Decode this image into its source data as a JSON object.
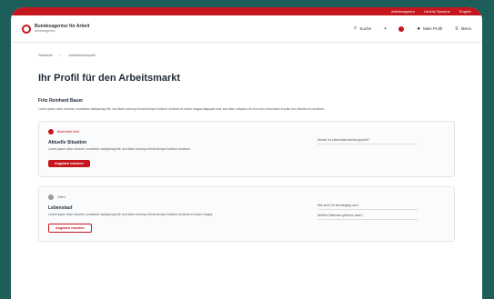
{
  "topbar": {
    "links": [
      "Arbeitsagentur",
      "Leichte Sprache",
      "English"
    ]
  },
  "header": {
    "logo_title": "Bundesagentur für Arbeit",
    "logo_sub": "Arbeitsagentur",
    "nav": {
      "search": "Suche",
      "profile": "Mein Profil",
      "menu": "Menü"
    }
  },
  "breadcrumb": [
    "Startseite",
    "Arbeitsmarktprofil"
  ],
  "page": {
    "title": "Ihr Profil für den Arbeitsmarkt",
    "name": "Fritz Reinhard Bauer",
    "intro": "Lorem ipsum dolor sit amet, consetetur sadipscing elitr, sed diam nonumy eirmod tempor invidunt ut labore et dolore magna aliquyam erat, sed diam voluptua. At vero eos et accusam et justo duo dolores et ea rebum."
  },
  "cards": [
    {
      "status": "Bearbeitet fehlt",
      "title": "Aktuelle Situation",
      "text": "Lorem ipsum dolor sit amet, consetetur sadipscing elitr, sed diam nonumy eirmod tempor invidunt ut labore.",
      "button": "Angaben machen",
      "aside": [
        "Wurde Ihr Lebenslauf bereits geprüft?"
      ]
    },
    {
      "status": "Offen",
      "title": "Lebenslauf",
      "text": "Lorem ipsum dolor sit amet, consetetur sadipscing elitr, sed diam nonumy eirmod tempor invidunt ut labore et dolore magna.",
      "button": "Angaben machen",
      "aside": [
        "Wie sieht Ihr Werdegang aus?",
        "Welche Stationen gehören dazu?"
      ]
    }
  ],
  "colors": {
    "brand": "#c4161c",
    "frame": "#1d5e5a"
  }
}
